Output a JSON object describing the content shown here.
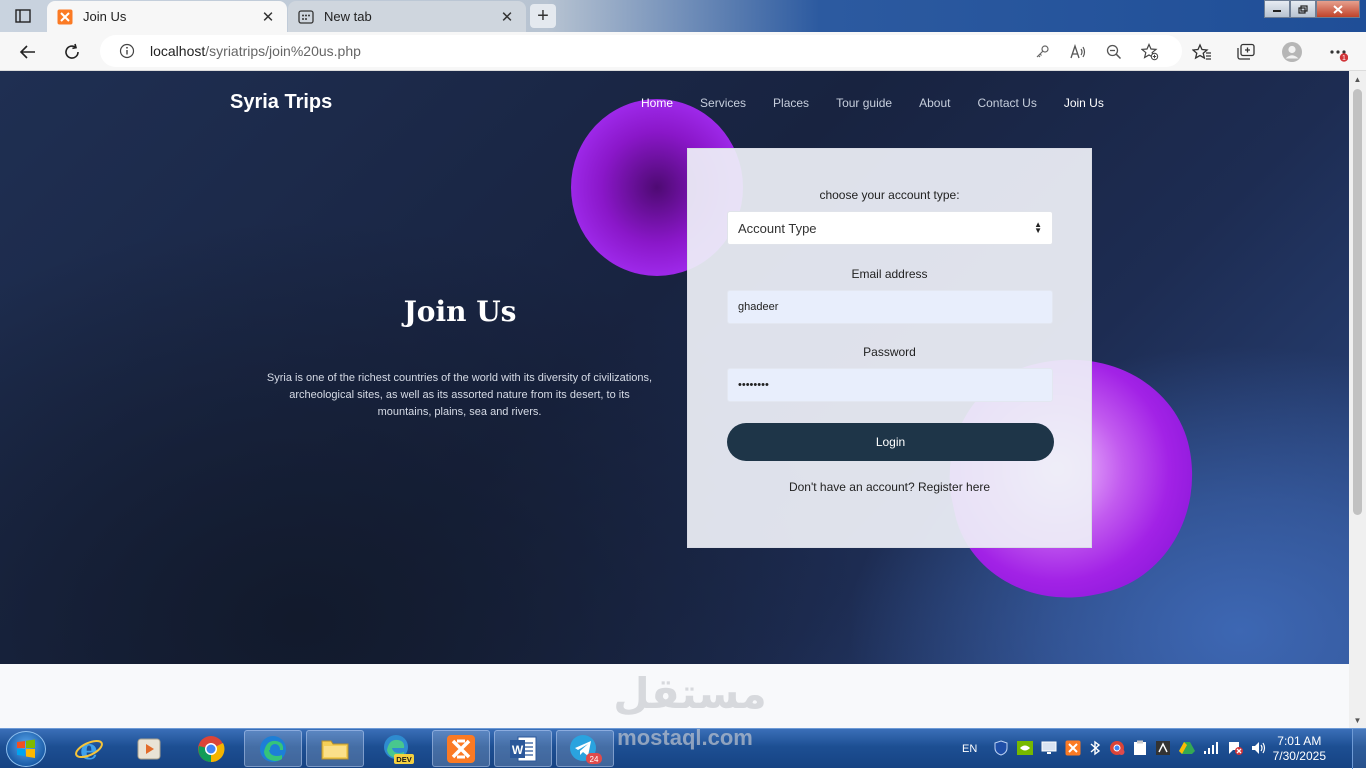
{
  "browser": {
    "tabs": [
      {
        "title": "Join Us",
        "active": true
      },
      {
        "title": "New tab",
        "active": false
      }
    ],
    "close_glyph": "✕",
    "new_tab_glyph": "+",
    "url_host": "localhost",
    "url_path": "/syriatrips/join%20us.php"
  },
  "site": {
    "brand": "Syria Trips",
    "nav": [
      "Home",
      "Services",
      "Places",
      "Tour guide",
      "About",
      "Contact Us",
      "Join Us"
    ]
  },
  "hero": {
    "title": "Join Us",
    "text": "Syria is one of the richest countries of the world with its diversity of civilizations, archeological sites, as well as its assorted nature from its desert, to its mountains, plains, sea and rivers."
  },
  "form": {
    "account_label": "choose your account type:",
    "account_value": "Account Type",
    "email_label": "Email address",
    "email_value": "ghadeer",
    "password_label": "Password",
    "password_value": "••••••••",
    "login_label": "Login",
    "register_text": "Don't have an account? Register here"
  },
  "watermark": {
    "arabic": "مستقل",
    "latin": "mostaql.com"
  },
  "taskbar": {
    "language": "EN",
    "time": "7:01 AM",
    "date": "7/30/2025",
    "notification_count": "1",
    "telegram_badge": "24",
    "dev_badge": "DEV"
  },
  "colors": {
    "hero_bg": "#1d2c52",
    "blob": "#9d28e8",
    "login_button": "#1e3548",
    "input_bg": "#e8eefc"
  }
}
